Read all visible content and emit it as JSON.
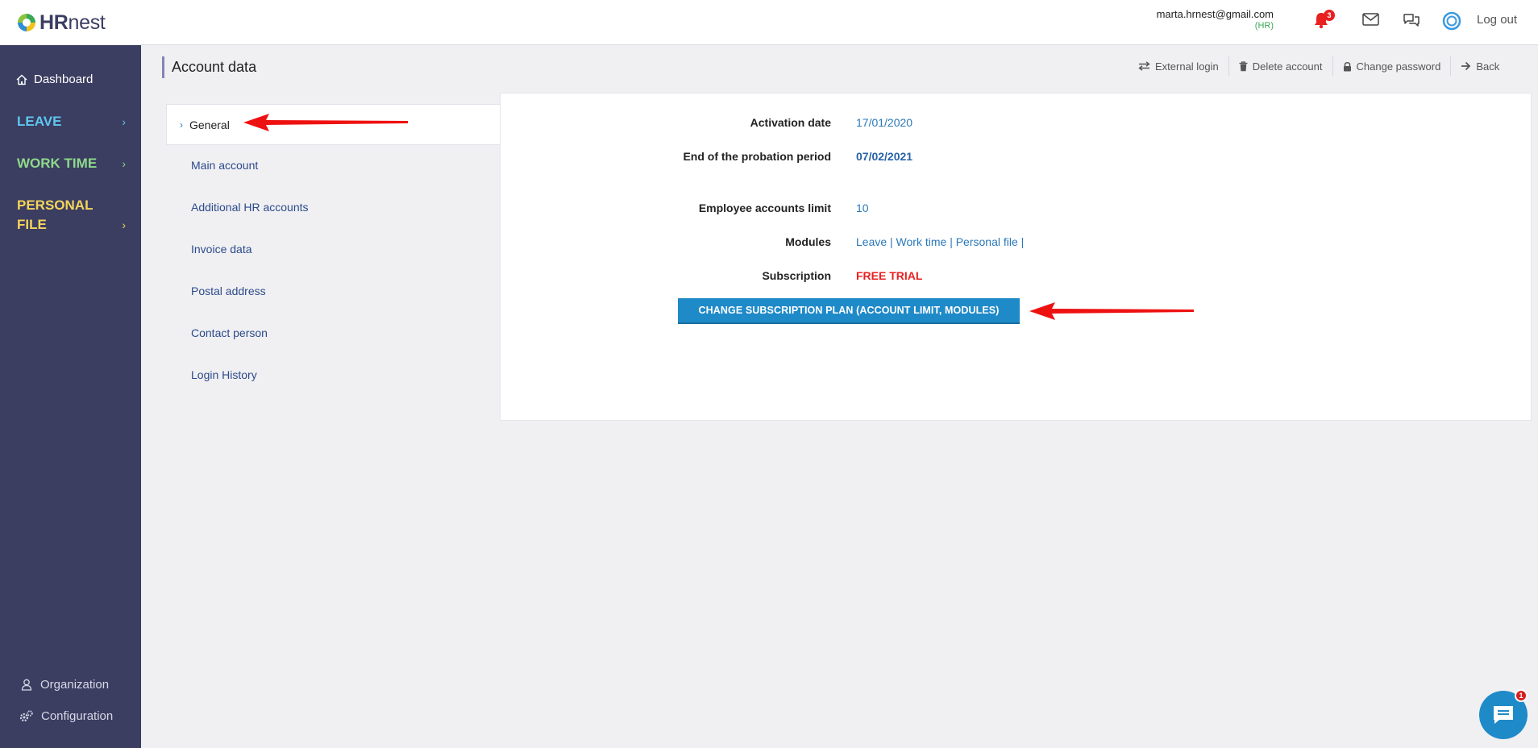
{
  "app": {
    "logo_bold": "HR",
    "logo_rest": "nest"
  },
  "header": {
    "user_email": "marta.hrnest@gmail.com",
    "user_role": "(HR)",
    "notifications_count": "3",
    "logout_label": "Log out"
  },
  "sidebar": {
    "dashboard": "Dashboard",
    "groups": [
      {
        "label": "LEAVE",
        "color": "#5ec7ef"
      },
      {
        "label": "WORK TIME",
        "color": "#8ed98a"
      },
      {
        "label": "PERSONAL FILE",
        "line1": "PERSONAL",
        "line2": "FILE",
        "color": "#f4d55b"
      }
    ],
    "organization": "Organization",
    "configuration": "Configuration"
  },
  "page": {
    "title": "Account data",
    "actions": {
      "external_login": "External login",
      "delete_account": "Delete account",
      "change_password": "Change password",
      "back": "Back"
    }
  },
  "tabs": {
    "active": "General",
    "items": [
      "Main account",
      "Additional HR accounts",
      "Invoice data",
      "Postal address",
      "Contact person",
      "Login History"
    ]
  },
  "general": {
    "activation_date_label": "Activation date",
    "activation_date_value": "17/01/2020",
    "probation_label": "End of the probation period",
    "probation_value": "07/02/2021",
    "accounts_limit_label": "Employee accounts limit",
    "accounts_limit_value": "10",
    "modules_label": "Modules",
    "modules_value": "Leave | Work time | Personal file |",
    "subscription_label": "Subscription",
    "subscription_value": "FREE TRIAL",
    "change_plan_button": "CHANGE SUBSCRIPTION PLAN (ACCOUNT LIMIT, MODULES)"
  },
  "chat": {
    "badge": "1"
  },
  "colors": {
    "sidebar_bg": "#3b3d61",
    "accent_blue": "#1f8ac8",
    "link_blue": "#2a78b8",
    "alert_red": "#e82020"
  }
}
